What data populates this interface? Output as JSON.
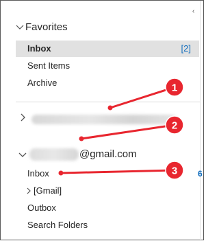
{
  "favorites": {
    "header": "Favorites",
    "items": [
      {
        "label": "Inbox",
        "count": "[2]",
        "selected": true
      },
      {
        "label": "Sent Items"
      },
      {
        "label": "Archive"
      }
    ]
  },
  "account": {
    "email_suffix": "@gmail.com",
    "folders": [
      {
        "label": "Inbox",
        "count": "6"
      },
      {
        "label": "[Gmail]"
      },
      {
        "label": "Outbox"
      },
      {
        "label": "Search Folders"
      }
    ]
  },
  "annotations": {
    "badges": [
      "1",
      "2",
      "3"
    ],
    "color": "#e8262f"
  },
  "colors": {
    "selected_bg": "#e1e1e1",
    "count_blue": "#0f6cbd",
    "annotation_red": "#e8262f"
  }
}
